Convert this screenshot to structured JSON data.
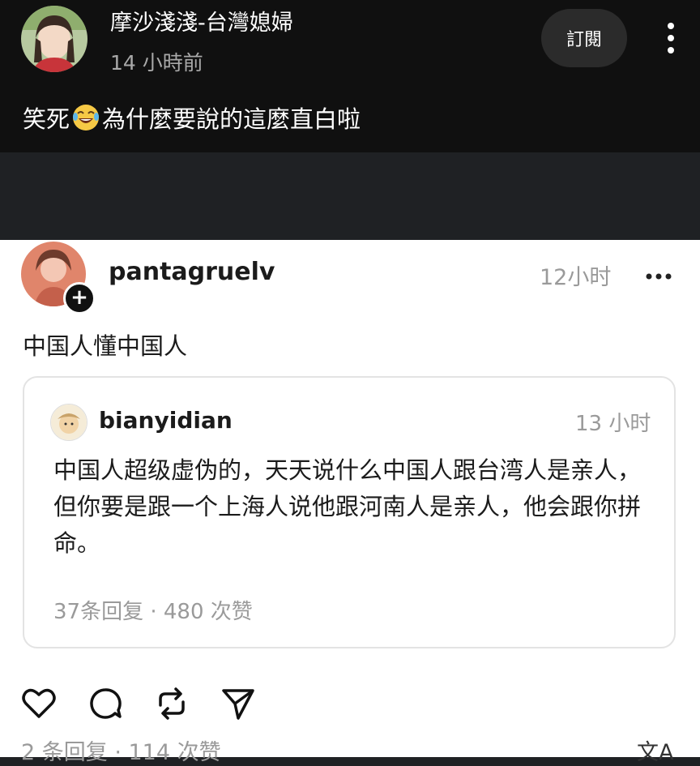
{
  "top_post": {
    "author": "摩沙淺淺-台灣媳婦",
    "time": "14 小時前",
    "subscribe_label": "訂閱",
    "text_before_emoji": "笑死",
    "emoji": "laughing-tears-emoji",
    "text_after_emoji": "為什麼要說的這麼直白啦"
  },
  "screenshot": {
    "author": "pantagruelv",
    "time": "12小时",
    "text": "中国人懂中国人",
    "quote": {
      "author": "bianyidian",
      "time": "13 小时",
      "body": "中国人超级虚伪的，天天说什么中国人跟台湾人是亲人，但你要是跟一个上海人说他跟河南人是亲人，他会跟你拼命。",
      "stats": "37条回复 · 480 次赞"
    },
    "stats": "2 条回复 · 114 次赞",
    "translate_glyph": "文A"
  },
  "icons": {
    "more_top": "more-vertical-icon",
    "more_card": "more-horizontal-icon",
    "like": "heart-icon",
    "comment": "comment-icon",
    "repost": "repost-icon",
    "share": "send-icon",
    "follow": "plus-icon",
    "translate": "translate-icon"
  },
  "colors": {
    "top_background": "#101010",
    "gap_background": "#1f2124",
    "card_background": "#ffffff",
    "muted_text": "#9a9a9a"
  }
}
